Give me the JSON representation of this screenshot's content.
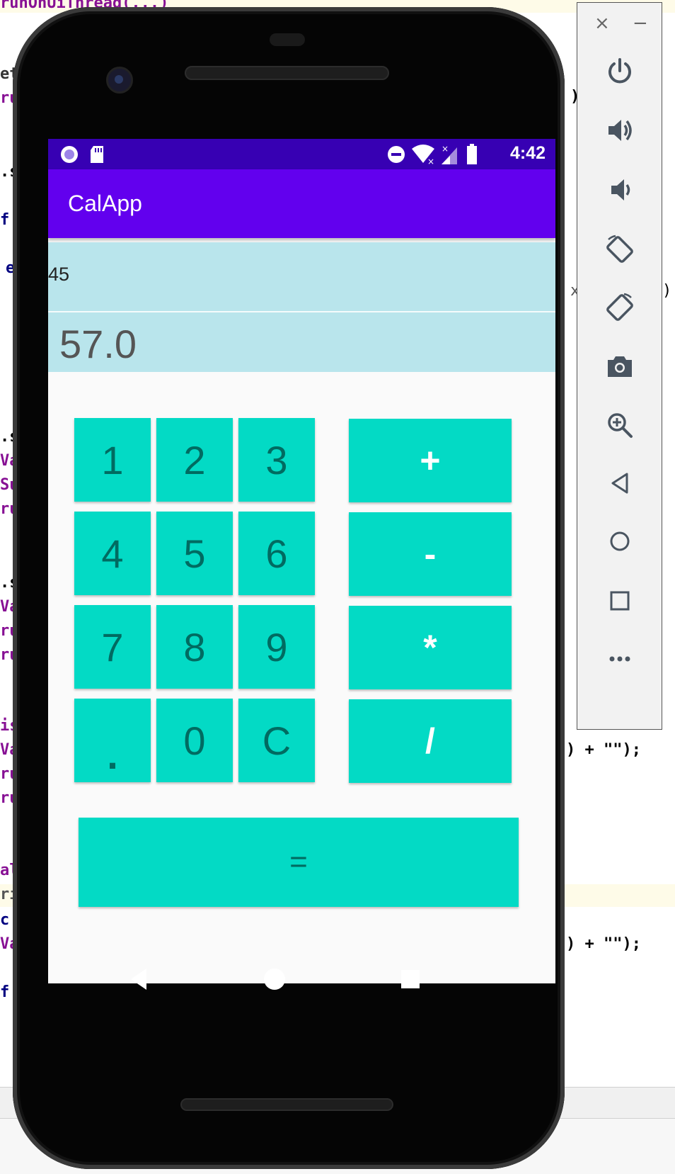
{
  "ide": {
    "lines": [
      {
        "text": "runOnUiThread(...)",
        "cls": "left"
      },
      {
        "text": "et"
      },
      {
        "text": "ru"
      },
      {
        "text": ".s"
      },
      {
        "text": "f"
      },
      {
        "text": "e"
      },
      {
        "text": ".s"
      },
      {
        "text": "Va"
      },
      {
        "text": "Su"
      },
      {
        "text": "ru"
      },
      {
        "text": ".s"
      },
      {
        "text": "Va"
      },
      {
        "text": "ru"
      },
      {
        "text": "ru"
      },
      {
        "text": "is"
      },
      {
        "text": "Va"
      },
      {
        "text": "ru"
      },
      {
        "text": "ru"
      },
      {
        "text": "al"
      },
      {
        "text": "ri"
      },
      {
        "text": "c"
      },
      {
        "text": "Va"
      },
      {
        "text": "f"
      }
    ],
    "right_snippets": [
      {
        "text": ")"
      },
      {
        "text": "x"
      },
      {
        "text": ")"
      },
      {
        "text": ") + \"\");"
      },
      {
        "text": ") + \"\");"
      }
    ]
  },
  "toolbar": {
    "close_label": "×",
    "minimize_label": "−",
    "buttons": [
      {
        "name": "power-icon",
        "label": "Power"
      },
      {
        "name": "volume-up-icon",
        "label": "Volume up"
      },
      {
        "name": "volume-down-icon",
        "label": "Volume down"
      },
      {
        "name": "rotate-left-icon",
        "label": "Rotate left"
      },
      {
        "name": "rotate-right-icon",
        "label": "Rotate right"
      },
      {
        "name": "camera-icon",
        "label": "Take screenshot"
      },
      {
        "name": "zoom-icon",
        "label": "Zoom"
      },
      {
        "name": "back-icon",
        "label": "Back"
      },
      {
        "name": "home-icon",
        "label": "Home"
      },
      {
        "name": "overview-icon",
        "label": "Overview"
      },
      {
        "name": "more-icon",
        "label": "More"
      }
    ]
  },
  "status": {
    "time": "4:42",
    "icons": [
      "record-icon",
      "sd-card-icon",
      "dnd-icon",
      "wifi-icon",
      "signal-icon",
      "battery-icon"
    ]
  },
  "app": {
    "title": "CalApp",
    "input_value": "45",
    "result_value": "57.0"
  },
  "keys": {
    "k1": "1",
    "k2": "2",
    "k3": "3",
    "k4": "4",
    "k5": "5",
    "k6": "6",
    "k7": "7",
    "k8": "8",
    "k9": "9",
    "kdot": ".",
    "k0": "0",
    "kc": "C",
    "plus": "+",
    "minus": "-",
    "mul": "*",
    "div": "/",
    "equals": "="
  },
  "colors": {
    "status_bar": "#3700b3",
    "app_bar": "#6200ee",
    "key": "#03dac5",
    "display": "#b9e5ec"
  }
}
